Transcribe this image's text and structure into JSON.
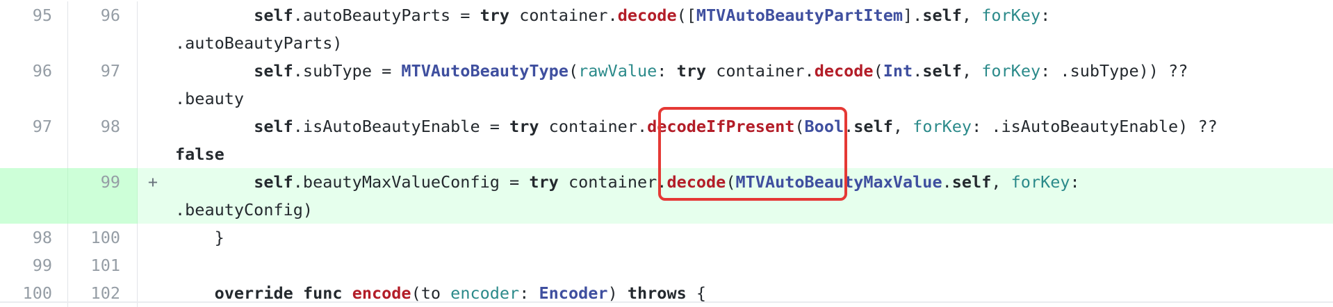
{
  "rows": [
    {
      "old": "95",
      "new": "96",
      "marker": "",
      "added": false,
      "lines": [
        [
          {
            "t": "        ",
            "c": "pl"
          },
          {
            "t": "self",
            "c": "kw"
          },
          {
            "t": ".autoBeautyParts = ",
            "c": "pl"
          },
          {
            "t": "try",
            "c": "kw"
          },
          {
            "t": " container.",
            "c": "pl"
          },
          {
            "t": "decode",
            "c": "fn"
          },
          {
            "t": "([",
            "c": "pl"
          },
          {
            "t": "MTVAutoBeautyPartItem",
            "c": "ty"
          },
          {
            "t": "].",
            "c": "pl"
          },
          {
            "t": "self",
            "c": "kw"
          },
          {
            "t": ", ",
            "c": "pl"
          },
          {
            "t": "forKey",
            "c": "lbl"
          },
          {
            "t": ":",
            "c": "pl"
          }
        ],
        [
          {
            "t": ".autoBeautyParts)",
            "c": "pl"
          }
        ]
      ]
    },
    {
      "old": "96",
      "new": "97",
      "marker": "",
      "added": false,
      "lines": [
        [
          {
            "t": "        ",
            "c": "pl"
          },
          {
            "t": "self",
            "c": "kw"
          },
          {
            "t": ".subType = ",
            "c": "pl"
          },
          {
            "t": "MTVAutoBeautyType",
            "c": "ty"
          },
          {
            "t": "(",
            "c": "pl"
          },
          {
            "t": "rawValue",
            "c": "lbl"
          },
          {
            "t": ": ",
            "c": "pl"
          },
          {
            "t": "try",
            "c": "kw"
          },
          {
            "t": " container.",
            "c": "pl"
          },
          {
            "t": "decode",
            "c": "fn"
          },
          {
            "t": "(",
            "c": "pl"
          },
          {
            "t": "Int",
            "c": "ty"
          },
          {
            "t": ".",
            "c": "pl"
          },
          {
            "t": "self",
            "c": "kw"
          },
          {
            "t": ", ",
            "c": "pl"
          },
          {
            "t": "forKey",
            "c": "lbl"
          },
          {
            "t": ": .subType)) ??",
            "c": "pl"
          }
        ],
        [
          {
            "t": ".beauty",
            "c": "pl"
          }
        ]
      ]
    },
    {
      "old": "97",
      "new": "98",
      "marker": "",
      "added": false,
      "lines": [
        [
          {
            "t": "        ",
            "c": "pl"
          },
          {
            "t": "self",
            "c": "kw"
          },
          {
            "t": ".isAutoBeautyEnable = ",
            "c": "pl"
          },
          {
            "t": "try",
            "c": "kw"
          },
          {
            "t": " container.",
            "c": "pl"
          },
          {
            "t": "decodeIfPresent",
            "c": "fn"
          },
          {
            "t": "(",
            "c": "pl"
          },
          {
            "t": "Bool",
            "c": "ty"
          },
          {
            "t": ".",
            "c": "pl"
          },
          {
            "t": "self",
            "c": "kw"
          },
          {
            "t": ", ",
            "c": "pl"
          },
          {
            "t": "forKey",
            "c": "lbl"
          },
          {
            "t": ": .isAutoBeautyEnable) ??",
            "c": "pl"
          }
        ],
        [
          {
            "t": "false",
            "c": "kw"
          }
        ]
      ]
    },
    {
      "old": "",
      "new": "99",
      "marker": "+",
      "added": true,
      "lines": [
        [
          {
            "t": "        ",
            "c": "pl"
          },
          {
            "t": "self",
            "c": "kw"
          },
          {
            "t": ".beautyMaxValueConfig = ",
            "c": "pl"
          },
          {
            "t": "try",
            "c": "kw"
          },
          {
            "t": " container.",
            "c": "pl"
          },
          {
            "t": "decode",
            "c": "fn"
          },
          {
            "t": "(",
            "c": "pl"
          },
          {
            "t": "MTVAutoBeautyMaxValue",
            "c": "ty"
          },
          {
            "t": ".",
            "c": "pl"
          },
          {
            "t": "self",
            "c": "kw"
          },
          {
            "t": ", ",
            "c": "pl"
          },
          {
            "t": "forKey",
            "c": "lbl"
          },
          {
            "t": ":",
            "c": "pl"
          }
        ],
        [
          {
            "t": ".beautyConfig)",
            "c": "pl"
          }
        ]
      ]
    },
    {
      "old": "98",
      "new": "100",
      "marker": "",
      "added": false,
      "lines": [
        [
          {
            "t": "    }",
            "c": "pl"
          }
        ]
      ]
    },
    {
      "old": "99",
      "new": "101",
      "marker": "",
      "added": false,
      "lines": [
        [
          {
            "t": "",
            "c": "pl"
          }
        ]
      ]
    },
    {
      "old": "100",
      "new": "102",
      "marker": "",
      "added": false,
      "lines": [
        [
          {
            "t": "    ",
            "c": "pl"
          },
          {
            "t": "override",
            "c": "kw"
          },
          {
            "t": " ",
            "c": "pl"
          },
          {
            "t": "func",
            "c": "kw"
          },
          {
            "t": " ",
            "c": "pl"
          },
          {
            "t": "encode",
            "c": "fn"
          },
          {
            "t": "(to ",
            "c": "pl"
          },
          {
            "t": "encoder",
            "c": "lbl"
          },
          {
            "t": ": ",
            "c": "pl"
          },
          {
            "t": "Encoder",
            "c": "ty"
          },
          {
            "t": ") ",
            "c": "pl"
          },
          {
            "t": "throws",
            "c": "kw"
          },
          {
            "t": " {",
            "c": "pl"
          }
        ]
      ]
    }
  ]
}
